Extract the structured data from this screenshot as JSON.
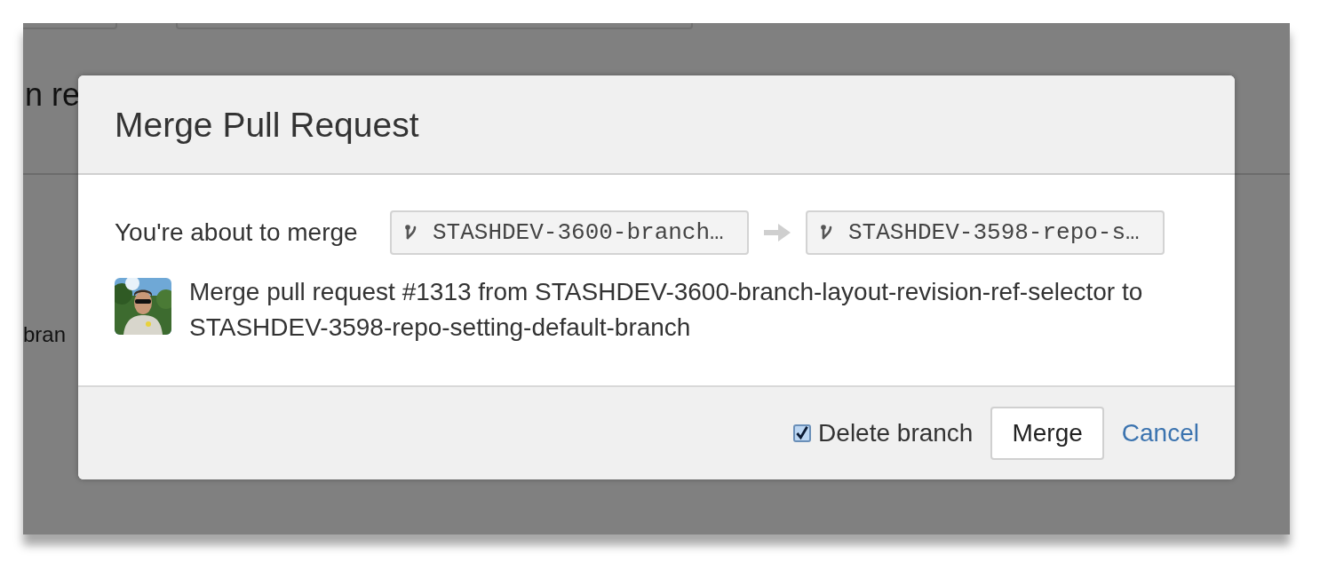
{
  "background": {
    "heading_fragment": "n re",
    "text_fragment": "bran"
  },
  "dialog": {
    "title": "Merge Pull Request",
    "merge_label": "You're about to merge",
    "source_branch": "STASHDEV-3600-branch…",
    "target_branch": "STASHDEV-3598-repo-s…",
    "commit_message": "Merge pull request #1313 from STASHDEV-3600-branch-layout-revision-ref-selector to STASHDEV-3598-repo-setting-default-branch",
    "delete_branch": {
      "label": "Delete branch",
      "checked": true
    },
    "buttons": [
      {
        "kind": "button",
        "label": "Merge"
      },
      {
        "kind": "link",
        "label": "Cancel"
      }
    ]
  }
}
